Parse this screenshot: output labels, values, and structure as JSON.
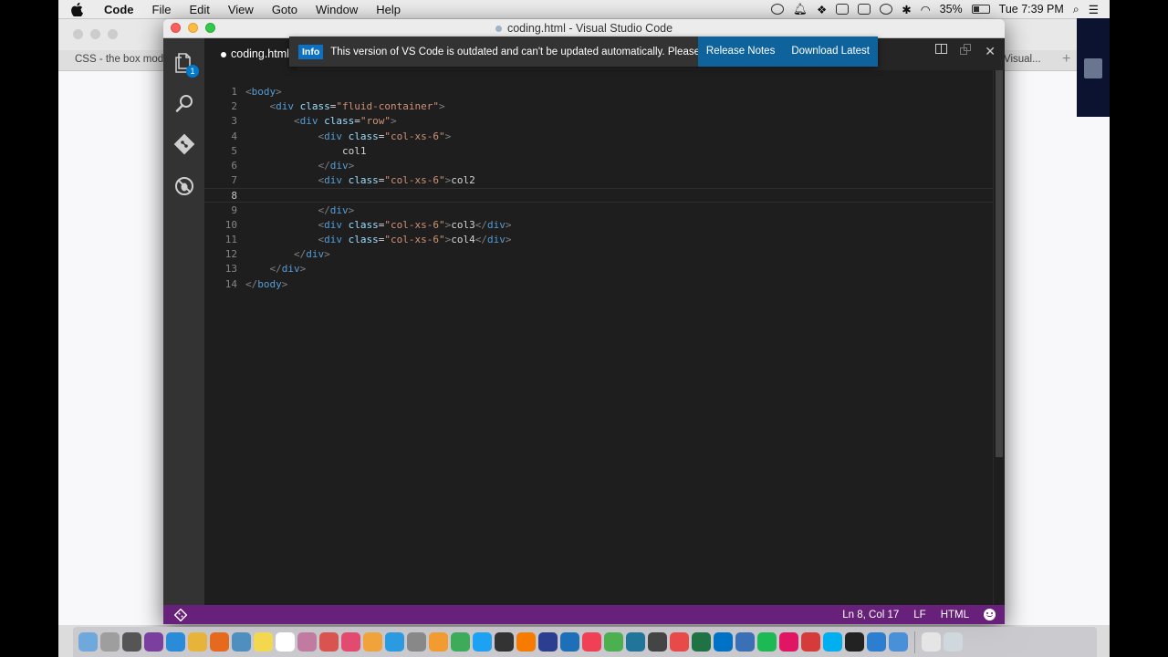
{
  "menubar": {
    "app_name": "Code",
    "items": [
      "File",
      "Edit",
      "View",
      "Goto",
      "Window",
      "Help"
    ],
    "battery": "35%",
    "clock": "Tue 7:39 PM"
  },
  "browser": {
    "tab_left": "CSS - the box mode",
    "tab_right": "Visual..."
  },
  "window": {
    "title": "coding.html - Visual Studio Code"
  },
  "activity": {
    "explorer_badge": "1",
    "icons": [
      "files-icon",
      "search-icon",
      "git-icon",
      "debug-icon"
    ]
  },
  "tab": {
    "label": "coding.html"
  },
  "notification": {
    "badge": "Info",
    "message": "This version of VS Code is outdated and can't be updated automatically. Please downlo...",
    "release_notes": "Release Notes",
    "download_latest": "Download Latest"
  },
  "editor": {
    "lines": [
      {
        "n": "1",
        "tokens": [
          [
            "p",
            "<"
          ],
          [
            "t",
            "body"
          ],
          [
            "p",
            ">"
          ]
        ]
      },
      {
        "n": "2",
        "tokens": [
          [
            "x",
            "    "
          ],
          [
            "p",
            "<"
          ],
          [
            "t",
            "div "
          ],
          [
            "a",
            "class"
          ],
          [
            "x",
            "="
          ],
          [
            "s",
            "\"fluid-container\""
          ],
          [
            "p",
            ">"
          ]
        ]
      },
      {
        "n": "3",
        "tokens": [
          [
            "x",
            "        "
          ],
          [
            "p",
            "<"
          ],
          [
            "t",
            "div "
          ],
          [
            "a",
            "class"
          ],
          [
            "x",
            "="
          ],
          [
            "s",
            "\"row\""
          ],
          [
            "p",
            ">"
          ]
        ]
      },
      {
        "n": "4",
        "tokens": [
          [
            "x",
            "            "
          ],
          [
            "p",
            "<"
          ],
          [
            "t",
            "div "
          ],
          [
            "a",
            "class"
          ],
          [
            "x",
            "="
          ],
          [
            "s",
            "\"col-xs-6\""
          ],
          [
            "p",
            ">"
          ]
        ]
      },
      {
        "n": "5",
        "tokens": [
          [
            "x",
            "                col1"
          ]
        ]
      },
      {
        "n": "6",
        "tokens": [
          [
            "x",
            "            "
          ],
          [
            "p",
            "</"
          ],
          [
            "t",
            "div"
          ],
          [
            "p",
            ">"
          ]
        ]
      },
      {
        "n": "7",
        "tokens": [
          [
            "x",
            "            "
          ],
          [
            "p",
            "<"
          ],
          [
            "t",
            "div "
          ],
          [
            "a",
            "class"
          ],
          [
            "x",
            "="
          ],
          [
            "s",
            "\"col-xs-6\""
          ],
          [
            "p",
            ">"
          ],
          [
            "x",
            "col2"
          ]
        ]
      },
      {
        "n": "8",
        "tokens": []
      },
      {
        "n": "9",
        "tokens": [
          [
            "x",
            "            "
          ],
          [
            "p",
            "</"
          ],
          [
            "t",
            "div"
          ],
          [
            "p",
            ">"
          ]
        ]
      },
      {
        "n": "10",
        "tokens": [
          [
            "x",
            "            "
          ],
          [
            "p",
            "<"
          ],
          [
            "t",
            "div "
          ],
          [
            "a",
            "class"
          ],
          [
            "x",
            "="
          ],
          [
            "s",
            "\"col-xs-6\""
          ],
          [
            "p",
            ">"
          ],
          [
            "x",
            "col3"
          ],
          [
            "p",
            "</"
          ],
          [
            "t",
            "div"
          ],
          [
            "p",
            ">"
          ]
        ]
      },
      {
        "n": "11",
        "tokens": [
          [
            "x",
            "            "
          ],
          [
            "p",
            "<"
          ],
          [
            "t",
            "div "
          ],
          [
            "a",
            "class"
          ],
          [
            "x",
            "="
          ],
          [
            "s",
            "\"col-xs-6\""
          ],
          [
            "p",
            ">"
          ],
          [
            "x",
            "col4"
          ],
          [
            "p",
            "</"
          ],
          [
            "t",
            "div"
          ],
          [
            "p",
            ">"
          ]
        ]
      },
      {
        "n": "12",
        "tokens": [
          [
            "x",
            "        "
          ],
          [
            "p",
            "</"
          ],
          [
            "t",
            "div"
          ],
          [
            "p",
            ">"
          ]
        ]
      },
      {
        "n": "13",
        "tokens": [
          [
            "x",
            "    "
          ],
          [
            "p",
            "</"
          ],
          [
            "t",
            "div"
          ],
          [
            "p",
            ">"
          ]
        ]
      },
      {
        "n": "14",
        "tokens": [
          [
            "p",
            "</"
          ],
          [
            "t",
            "body"
          ],
          [
            "p",
            ">"
          ]
        ]
      }
    ],
    "current_line": "8"
  },
  "statusbar": {
    "position": "Ln 8, Col 17",
    "eol": "LF",
    "language": "HTML"
  },
  "colors": {
    "statusbar": "#68217a",
    "activity_bar": "#333333",
    "editor_bg": "#1e1e1e",
    "accent_blue": "#0e639c"
  },
  "dock": {
    "icons": [
      "finder-icon",
      "launchpad-icon",
      "rocket-icon",
      "onenote-icon",
      "safari-icon",
      "chrome-icon",
      "firefox-icon",
      "preview-icon",
      "notes-icon",
      "calendar-icon",
      "photos-icon",
      "popcorn-icon",
      "itunes-icon",
      "ibooks-icon",
      "appstore-icon",
      "syspref-icon",
      "flux-icon",
      "android-icon",
      "twitter-icon",
      "clock-icon",
      "sublime-icon",
      "eclipse-icon",
      "vscode-w-icon",
      "pocket-icon",
      "chrome2-icon",
      "wordpress-icon",
      "unity-icon",
      "skype-like-icon",
      "excel-icon",
      "outlook-icon",
      "wifi-icon",
      "spotify-icon",
      "slack-icon",
      "smart-icon",
      "skype-icon",
      "terminal-icon",
      "vscode-icon",
      "quicktime-icon",
      "downloads-icon",
      "trash-icon"
    ]
  }
}
